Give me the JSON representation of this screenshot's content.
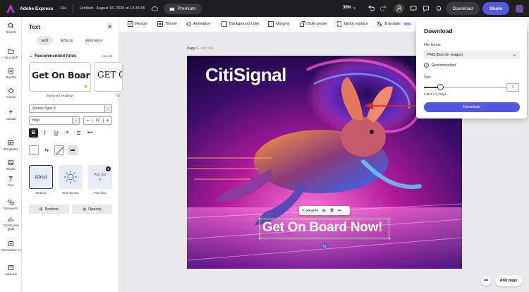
{
  "topbar": {
    "app_name": "Adobe Express",
    "file_menu": "File",
    "doc_title": "Untitled - August 18, 2025 at 14.35.55",
    "premium_label": "Premium",
    "zoom": "39%",
    "download_label": "Download",
    "share_label": "Share"
  },
  "rail": {
    "items": [
      "Search",
      "Your stuff",
      "Brands",
      "Assets",
      "Upload",
      "Templates",
      "Media",
      "Text",
      "Elements",
      "Charts and grids",
      "Generative AI",
      "Add-ons"
    ]
  },
  "panel": {
    "title": "Text",
    "tabs": [
      "Edit",
      "Effects",
      "Animation"
    ],
    "recommended_heading": "Recommended fonts",
    "view_all": "View all",
    "card1_preview": "Get On Board",
    "card1_label": "Stand-out headings",
    "card2_preview": "GET O",
    "card2_label": "Or",
    "font_family": "Source Sans 3",
    "font_weight": "Bold",
    "font_size": "92",
    "presets": [
      "Default",
      "Text layouts",
      "Text flow"
    ],
    "preset_default_text": "Abcd",
    "preset_flow_text": "Abc def g",
    "position_label": "Position",
    "opacity_label": "Opacity"
  },
  "toolbar": {
    "tools": [
      "Resize",
      "Theme",
      "Animation",
      "Background color",
      "Margins",
      "Bulk create",
      "Quick replace",
      "Translate"
    ],
    "new_badge": "NEW"
  },
  "canvas": {
    "page_label": "Page 1",
    "page_title_placeholder": "- Add title",
    "brand_text": "CitiSignal",
    "headline": "Get On Board Now!",
    "ctx_rewrite": "Rewrite"
  },
  "download_popover": {
    "title": "Download",
    "format_label": "File format",
    "format_value": "PNG (Best for images)",
    "recommended": "Recommended",
    "size_label": "Size",
    "size_value": "1",
    "size_fraction": 0.2,
    "dimensions": "2,304 x 1,792px",
    "button": "Download"
  },
  "bottom": {
    "more": "•••",
    "add_page": "Add page"
  },
  "colors": {
    "accent": "#5258e4",
    "topbar": "#1f1f22",
    "arrow": "#d22a1f"
  }
}
